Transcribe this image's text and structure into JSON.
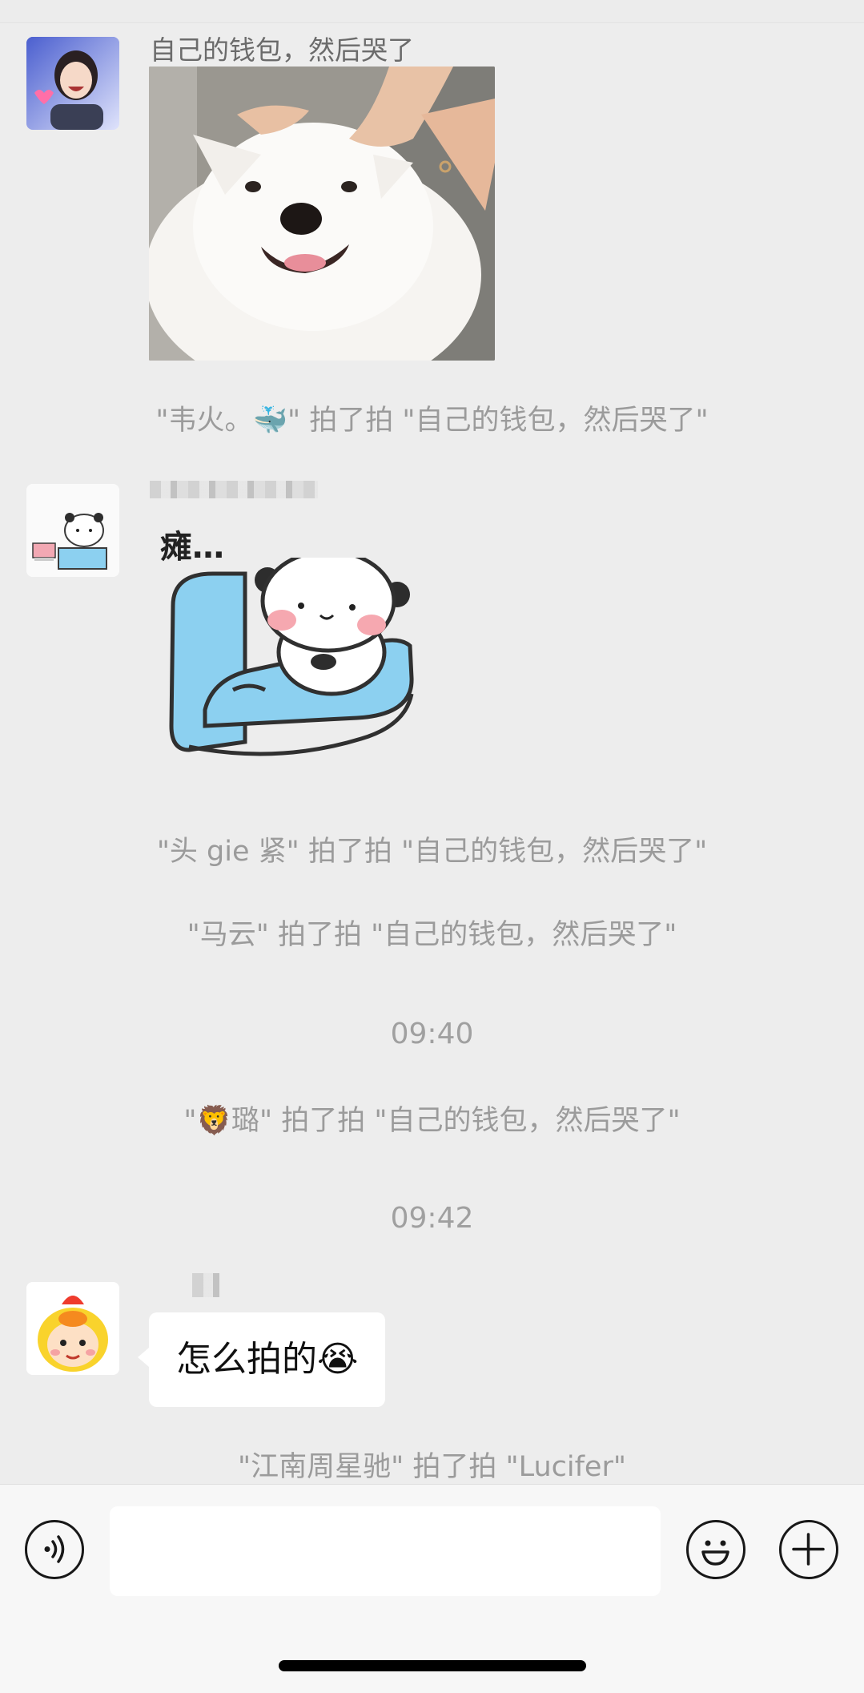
{
  "chat": {
    "messages": [
      {
        "sender": "自己的钱包，然后哭了",
        "type": "image",
        "image": "samoyed-dog-photo"
      },
      {
        "system": "\"韦火。🐳\" 拍了拍 \"自己的钱包，然后哭了\""
      },
      {
        "sender_blurred": true,
        "type": "sticker",
        "sticker_caption": "瘫…",
        "sticker": "panda-in-blue-armchair"
      },
      {
        "system": "\"头 gie 紧\" 拍了拍 \"自己的钱包，然后哭了\""
      },
      {
        "system": "\"马云\" 拍了拍 \"自己的钱包，然后哭了\""
      },
      {
        "time": "09:40"
      },
      {
        "system": "\"🦁璐\" 拍了拍 \"自己的钱包，然后哭了\""
      },
      {
        "time": "09:42"
      },
      {
        "sender_blurred": true,
        "type": "text",
        "text": "怎么拍的😭"
      },
      {
        "system": "\"江南周星驰\" 拍了拍 \"Lucifer\""
      }
    ]
  },
  "input_bar": {
    "voice_icon": "voice-icon",
    "emoji_icon": "emoji-icon",
    "plus_icon": "plus-icon",
    "text_value": ""
  },
  "colors": {
    "background": "#ededed",
    "bubble": "#ffffff",
    "system_text": "#9b9b9b",
    "input_bar": "#f7f7f7",
    "sofa": "#8cd0f0"
  }
}
